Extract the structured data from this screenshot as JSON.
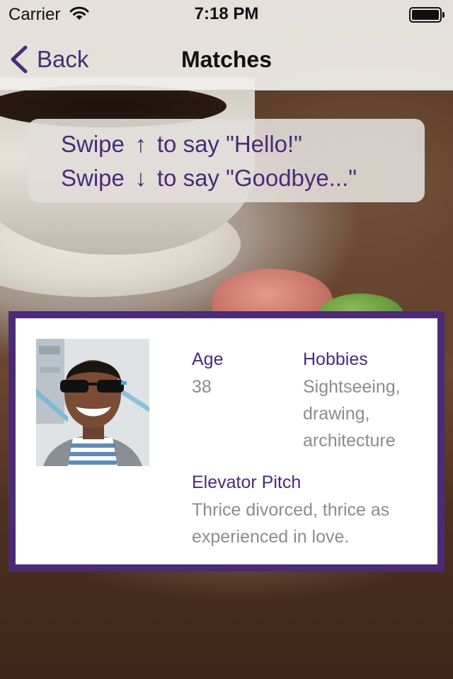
{
  "status_bar": {
    "carrier": "Carrier",
    "time": "7:18 PM"
  },
  "nav": {
    "back_label": "Back",
    "title": "Matches"
  },
  "hint": {
    "up_prefix": "Swipe",
    "up_arrow": "↑",
    "up_text": "to say \"Hello!\"",
    "down_prefix": "Swipe",
    "down_arrow": "↓",
    "down_text": "to say \"Goodbye...\""
  },
  "profile": {
    "age_label": "Age",
    "age_value": "38",
    "hobbies_label": "Hobbies",
    "hobbies_lines": [
      "Sightseeing,",
      "drawing,",
      "architecture"
    ],
    "pitch_label": "Elevator Pitch",
    "pitch_lines": [
      "Thrice divorced, thrice as",
      "experienced in love."
    ]
  },
  "colors": {
    "accent": "#4b2b76",
    "secondary_text": "#8c8c8c"
  }
}
